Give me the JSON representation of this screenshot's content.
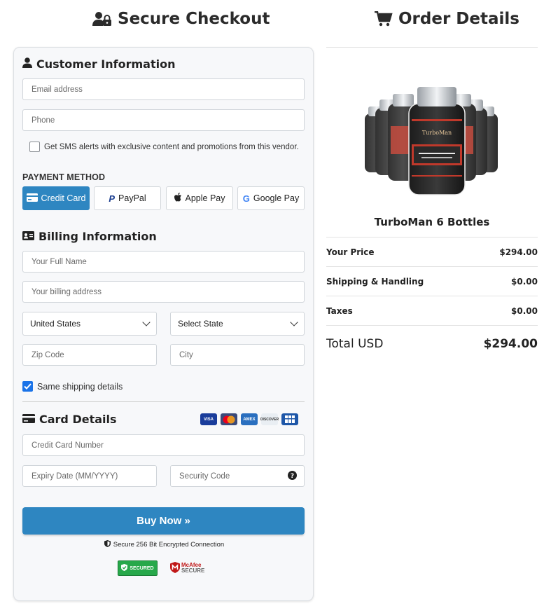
{
  "checkout_title": "Secure Checkout",
  "order_title": "Order Details",
  "customer": {
    "title": "Customer Information",
    "email_placeholder": "Email address",
    "phone_placeholder": "Phone",
    "sms_label": "Get SMS alerts with exclusive content and promotions from this vendor."
  },
  "payment": {
    "label": "PAYMENT METHOD",
    "methods": [
      "Credit Card",
      "PayPal",
      "Apple Pay",
      "Google Pay"
    ],
    "selected": "Credit Card"
  },
  "billing": {
    "title": "Billing Information",
    "name_placeholder": "Your Full Name",
    "address_placeholder": "Your billing address",
    "country": "United States",
    "state": "Select State",
    "zip_placeholder": "Zip Code",
    "city_placeholder": "City",
    "same_shipping_label": "Same shipping details",
    "same_shipping_checked": true
  },
  "card": {
    "title": "Card Details",
    "brands": [
      "VISA",
      "MC",
      "AMEX",
      "DISCOVER",
      "JCB"
    ],
    "number_placeholder": "Credit Card Number",
    "expiry_placeholder": "Expiry Date (MM/YYYY)",
    "cvv_placeholder": "Security Code"
  },
  "buy_button": "Buy Now »",
  "secure_text": "Secure 256 Bit Encrypted Connection",
  "seals": {
    "green": "SECURED",
    "mcafee_top": "McAfee",
    "mcafee_bottom": "SECURE"
  },
  "order": {
    "product_name": "TurboMan 6 Bottles",
    "product_brand": "TurboMan",
    "rows": [
      {
        "label": "Your Price",
        "value": "$294.00"
      },
      {
        "label": "Shipping & Handling",
        "value": "$0.00"
      },
      {
        "label": "Taxes",
        "value": "$0.00"
      }
    ],
    "total_label": "Total USD",
    "total_value": "$294.00"
  },
  "colors": {
    "accent": "#2e86c1",
    "checkbox": "#1a73e8"
  }
}
